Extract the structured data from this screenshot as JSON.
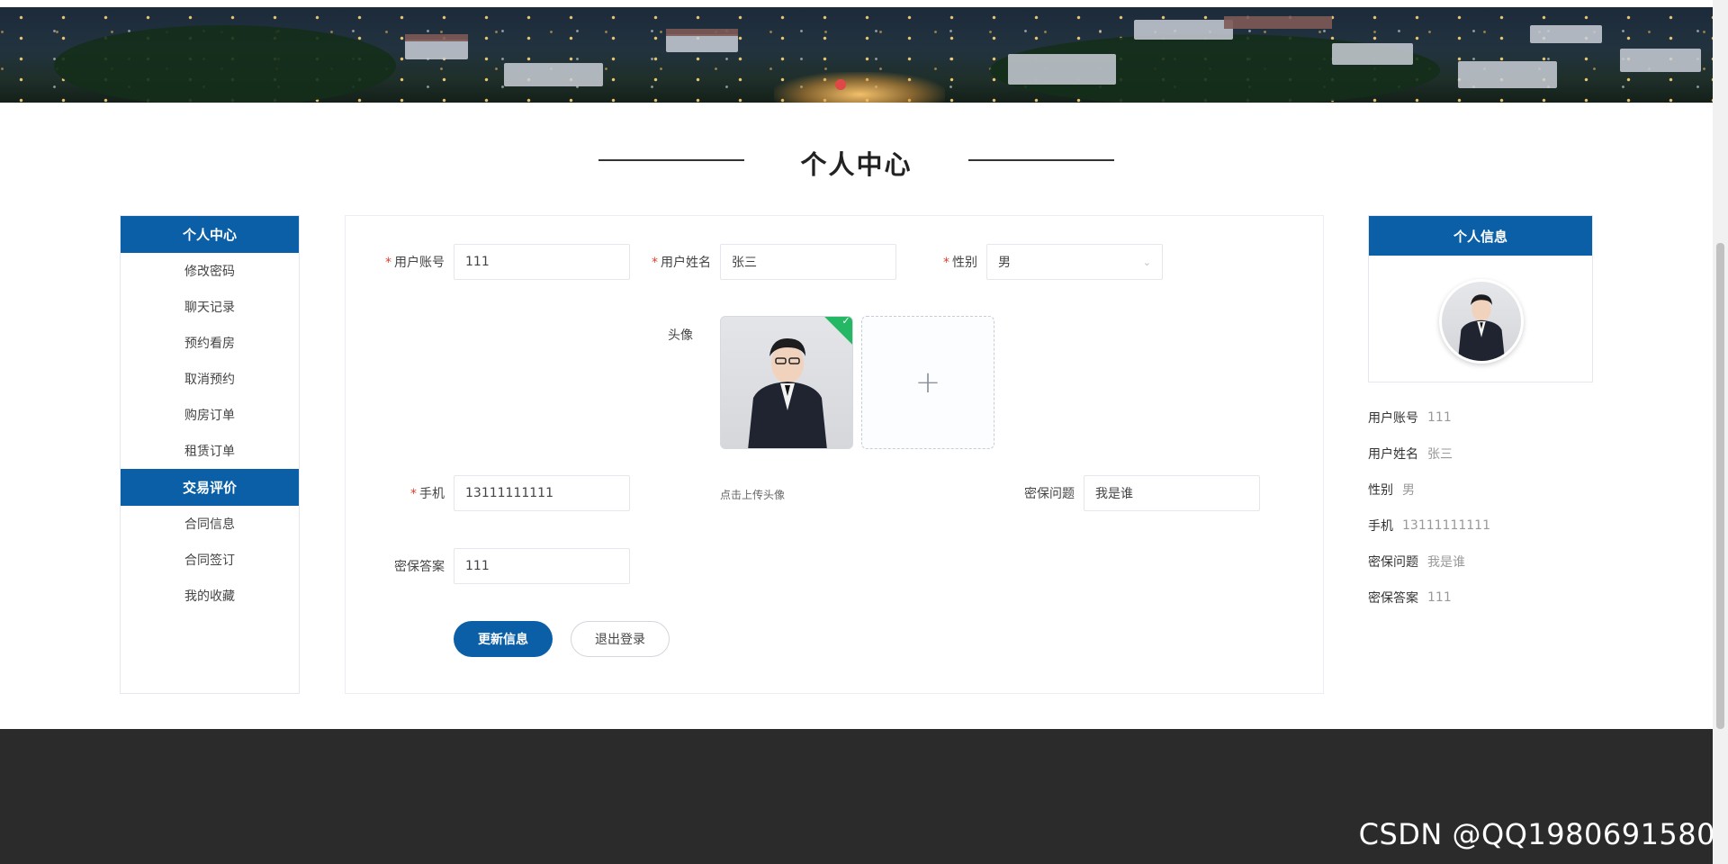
{
  "page": {
    "title": "个人中心"
  },
  "sidebar": {
    "group1_title": "个人中心",
    "group1_items": [
      "修改密码",
      "聊天记录",
      "预约看房",
      "取消预约",
      "购房订单",
      "租赁订单"
    ],
    "group2_title": "交易评价",
    "group2_items": [
      "合同信息",
      "合同签订",
      "我的收藏"
    ]
  },
  "form": {
    "account": {
      "label": "用户账号",
      "value": "111",
      "required": true
    },
    "name": {
      "label": "用户姓名",
      "value": "张三",
      "required": true
    },
    "gender": {
      "label": "性别",
      "value": "男",
      "required": true
    },
    "avatar": {
      "label": "头像",
      "tip": "点击上传头像",
      "add_symbol": "+"
    },
    "phone": {
      "label": "手机",
      "value": "13111111111",
      "required": true
    },
    "question": {
      "label": "密保问题",
      "value": "我是谁"
    },
    "answer": {
      "label": "密保答案",
      "value": "111"
    },
    "required_mark": "*",
    "buttons": {
      "update": "更新信息",
      "logout": "退出登录"
    }
  },
  "profile": {
    "title": "个人信息",
    "rows": [
      {
        "k": "用户账号",
        "v": "111"
      },
      {
        "k": "用户姓名",
        "v": "张三"
      },
      {
        "k": "性别",
        "v": "男"
      },
      {
        "k": "手机",
        "v": "13111111111"
      },
      {
        "k": "密保问题",
        "v": "我是谁"
      },
      {
        "k": "密保答案",
        "v": "111"
      }
    ]
  },
  "watermark": "CSDN @QQ1980691580",
  "colors": {
    "primary": "#0a5fa7",
    "footer": "#2b2b2b",
    "required": "#e0402b",
    "success": "#25b864"
  }
}
